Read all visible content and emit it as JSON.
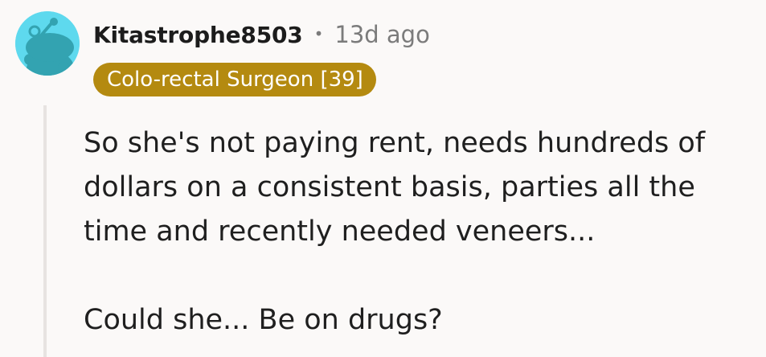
{
  "comment": {
    "avatar": {
      "icon": "reddit-snoo-avatar-icon",
      "background_color": "#5ED9EE",
      "figure_color": "#33A3B1"
    },
    "username": "Kitastrophe8503",
    "separator": "•",
    "timestamp": "13d ago",
    "flair": {
      "label": "Colo-rectal Surgeon [39]",
      "background_color": "#B48A10",
      "text_color": "#FFFFFF"
    },
    "body": {
      "paragraph_1": "So she's not paying rent, needs hundreds of dollars on a consistent basis, parties all the time and recently needed veneers...",
      "paragraph_2": "Could she... Be on drugs?"
    }
  }
}
